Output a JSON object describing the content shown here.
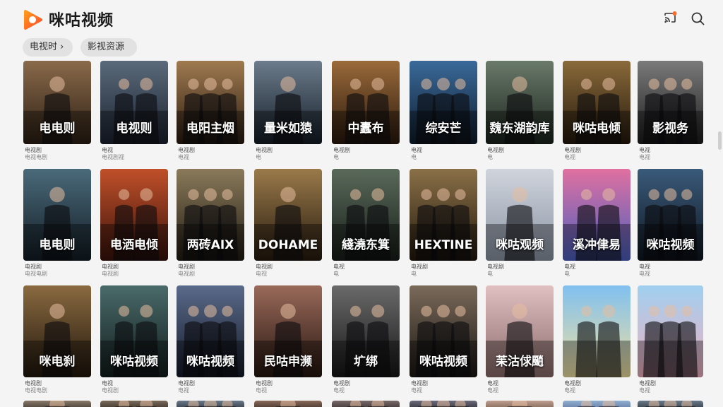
{
  "app": {
    "title": "咪咕视频"
  },
  "header": {
    "cast_icon": "cast-icon",
    "search_icon": "search-icon"
  },
  "chips": [
    {
      "label": "电视时 ›"
    },
    {
      "label": "影视资源"
    }
  ],
  "rows": [
    {
      "cards": [
        {
          "title": "电电则",
          "meta1": "电视剧",
          "meta2": "电视电剧",
          "palette": [
            "#8a6a4a",
            "#2b1e14"
          ]
        },
        {
          "title": "电视则",
          "meta1": "电视",
          "meta2": "电视剧视",
          "palette": [
            "#5a6a7a",
            "#1b2230"
          ]
        },
        {
          "title": "电阳主烟",
          "meta1": "电视剧",
          "meta2": "电视",
          "palette": [
            "#a07a50",
            "#2a1c10"
          ]
        },
        {
          "title": "量米如猿",
          "meta1": "电视剧",
          "meta2": "电",
          "palette": [
            "#6c7c8c",
            "#141c26"
          ]
        },
        {
          "title": "中蠹布",
          "meta1": "电视剧",
          "meta2": "电",
          "palette": [
            "#9a6a3a",
            "#2a180c"
          ]
        },
        {
          "title": "综安芒",
          "meta1": "电视",
          "meta2": "电",
          "palette": [
            "#3a6a9a",
            "#0e1c2c"
          ]
        },
        {
          "title": "魏东湖韵库",
          "meta1": "电视剧",
          "meta2": "电",
          "palette": [
            "#6a7a6a",
            "#1a221c"
          ]
        },
        {
          "title": "咪咕电倾",
          "meta1": "电视剧",
          "meta2": "电视",
          "palette": [
            "#8a6a3a",
            "#24180c"
          ]
        },
        {
          "title": "影视务",
          "meta1": "电视",
          "meta2": "电视",
          "palette": [
            "#7a7a7a",
            "#1c1c1c"
          ]
        }
      ]
    },
    {
      "cards": [
        {
          "title": "电电则",
          "meta1": "电视剧",
          "meta2": "电视电剧",
          "palette": [
            "#4a6a7a",
            "#121c24"
          ]
        },
        {
          "title": "电洒电倾",
          "meta1": "电视剧",
          "meta2": "电视剧",
          "palette": [
            "#c0502a",
            "#3a120a"
          ]
        },
        {
          "title": "两砖AIX",
          "meta1": "电视剧",
          "meta2": "电视剧",
          "palette": [
            "#8a7a5a",
            "#201a12"
          ]
        },
        {
          "title": "DOHAME",
          "meta1": "电视剧",
          "meta2": "电视",
          "palette": [
            "#9a7a4a",
            "#261a0e"
          ]
        },
        {
          "title": "綫澆东箕",
          "meta1": "电视",
          "meta2": "电",
          "palette": [
            "#5a6a5a",
            "#161c18"
          ]
        },
        {
          "title": "HEXTINE",
          "meta1": "电视剧",
          "meta2": "电",
          "palette": [
            "#8a7048",
            "#22180c"
          ]
        },
        {
          "title": "咪咕观频",
          "meta1": "电视剧",
          "meta2": "电",
          "palette": [
            "#d0d4dc",
            "#8a94a4"
          ]
        },
        {
          "title": "溪冲侓易",
          "meta1": "电视",
          "meta2": "电",
          "palette": [
            "#e070a0",
            "#4a60c0"
          ]
        },
        {
          "title": "咪咕视频",
          "meta1": "电视",
          "meta2": "电视",
          "palette": [
            "#3a5a7a",
            "#0e1620"
          ]
        }
      ]
    },
    {
      "cards": [
        {
          "title": "咪电刹",
          "meta1": "电视剧",
          "meta2": "电视电剧",
          "palette": [
            "#8a6a40",
            "#20160c"
          ]
        },
        {
          "title": "咪咕视频",
          "meta1": "电视",
          "meta2": "电视剧",
          "palette": [
            "#4a6a6a",
            "#121c1c"
          ]
        },
        {
          "title": "咪咕视频",
          "meta1": "电视剧",
          "meta2": "电视",
          "palette": [
            "#5a6a8a",
            "#141a28"
          ]
        },
        {
          "title": "民咕申濒",
          "meta1": "电视剧",
          "meta2": "电视",
          "palette": [
            "#9a6a5a",
            "#24140e"
          ]
        },
        {
          "title": "圹绑",
          "meta1": "电视剧",
          "meta2": "电视",
          "palette": [
            "#6a6a6a",
            "#161616"
          ]
        },
        {
          "title": "咪咕视频",
          "meta1": "电视剧",
          "meta2": "电视",
          "palette": [
            "#7a6a5a",
            "#1a1612"
          ]
        },
        {
          "title": "苿沽俅颵",
          "meta1": "电视",
          "meta2": "电视",
          "palette": [
            "#e0c0c0",
            "#8a6a6a"
          ]
        },
        {
          "title": "",
          "meta1": "电视剧",
          "meta2": "电视",
          "palette": [
            "#80c0f0",
            "#f0e0a0"
          ]
        },
        {
          "title": "",
          "meta1": "电视剧",
          "meta2": "电视",
          "palette": [
            "#a0d0f0",
            "#f0b0c0"
          ]
        }
      ]
    },
    {
      "cards": [
        {
          "title": "",
          "meta1": "",
          "meta2": "",
          "palette": [
            "#8a7a6a",
            "#1a1612"
          ]
        },
        {
          "title": "",
          "meta1": "",
          "meta2": "",
          "palette": [
            "#7a6a5a",
            "#1a1612"
          ]
        },
        {
          "title": "",
          "meta1": "",
          "meta2": "",
          "palette": [
            "#6a7a8a",
            "#12161a"
          ]
        },
        {
          "title": "",
          "meta1": "",
          "meta2": "",
          "palette": [
            "#8a6a5a",
            "#1a1410"
          ]
        },
        {
          "title": "",
          "meta1": "",
          "meta2": "",
          "palette": [
            "#7a6a6a",
            "#181414"
          ]
        },
        {
          "title": "",
          "meta1": "",
          "meta2": "",
          "palette": [
            "#6a6a7a",
            "#141418"
          ]
        },
        {
          "title": "",
          "meta1": "",
          "meta2": "",
          "palette": [
            "#c0a090",
            "#5a4030"
          ]
        },
        {
          "title": "",
          "meta1": "",
          "meta2": "",
          "palette": [
            "#90b0d0",
            "#4a5a8a"
          ]
        },
        {
          "title": "",
          "meta1": "",
          "meta2": "",
          "palette": [
            "#6a7a8a",
            "#141820"
          ]
        }
      ]
    }
  ]
}
